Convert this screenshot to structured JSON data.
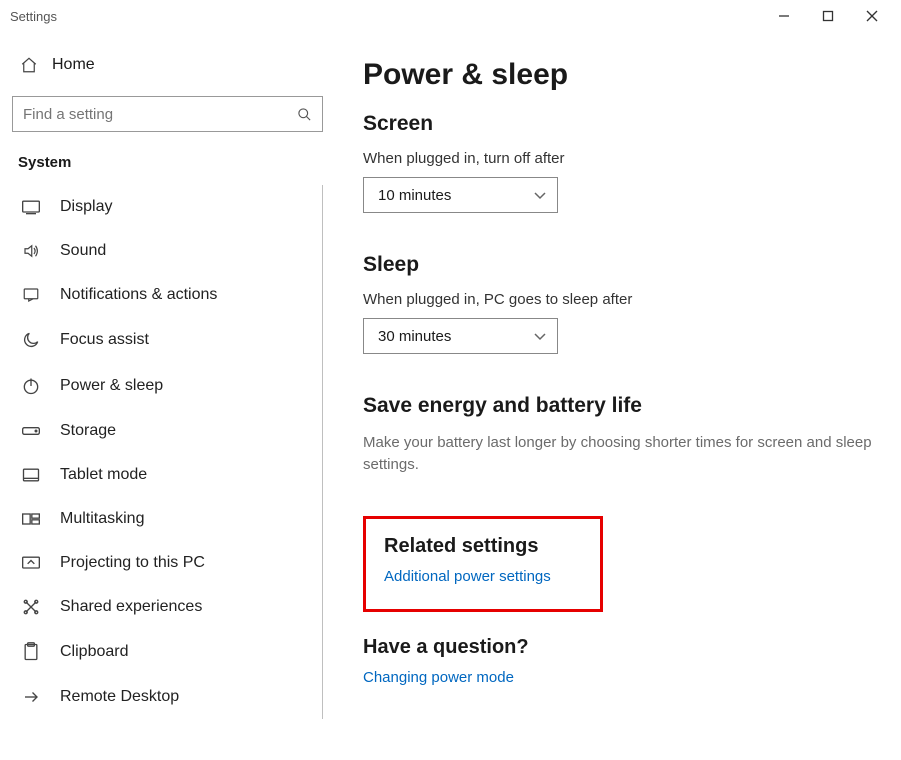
{
  "window_title": "Settings",
  "sidebar": {
    "home": "Home",
    "search_placeholder": "Find a setting",
    "section": "System",
    "items": [
      {
        "label": "Display"
      },
      {
        "label": "Sound"
      },
      {
        "label": "Notifications & actions"
      },
      {
        "label": "Focus assist"
      },
      {
        "label": "Power & sleep"
      },
      {
        "label": "Storage"
      },
      {
        "label": "Tablet mode"
      },
      {
        "label": "Multitasking"
      },
      {
        "label": "Projecting to this PC"
      },
      {
        "label": "Shared experiences"
      },
      {
        "label": "Clipboard"
      },
      {
        "label": "Remote Desktop"
      }
    ]
  },
  "main": {
    "title": "Power & sleep",
    "screen": {
      "heading": "Screen",
      "label": "When plugged in, turn off after",
      "value": "10 minutes"
    },
    "sleep": {
      "heading": "Sleep",
      "label": "When plugged in, PC goes to sleep after",
      "value": "30 minutes"
    },
    "energy": {
      "heading": "Save energy and battery life",
      "text": "Make your battery last longer by choosing shorter times for screen and sleep settings."
    },
    "related": {
      "heading": "Related settings",
      "link": "Additional power settings"
    },
    "question": {
      "heading": "Have a question?",
      "link": "Changing power mode"
    }
  }
}
